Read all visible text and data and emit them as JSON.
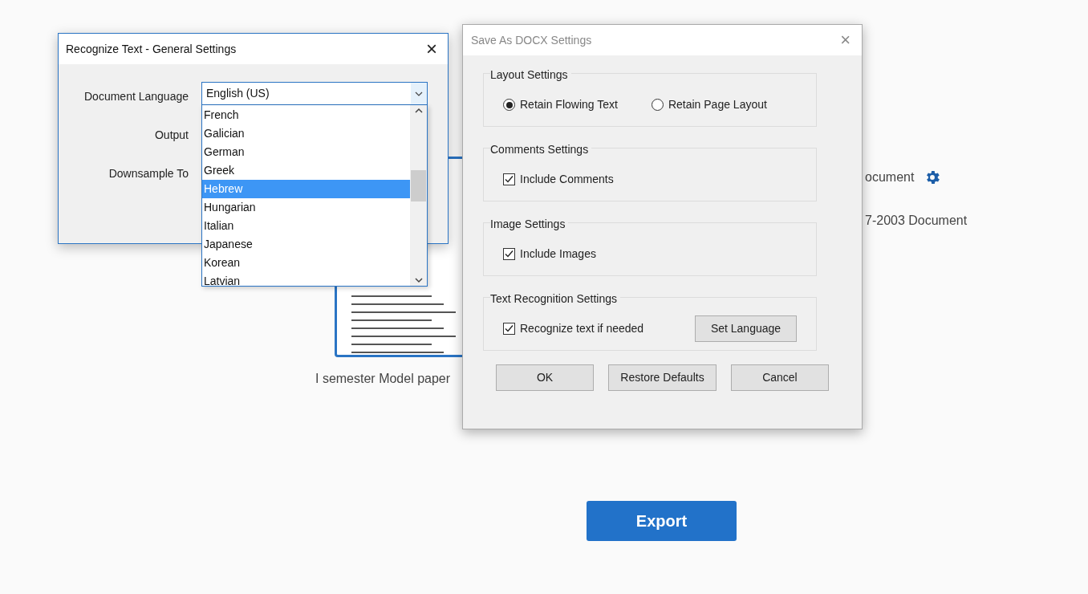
{
  "background": {
    "formats": [
      {
        "label": "ocument",
        "has_settings": true
      },
      {
        "label": "7-2003 Document",
        "has_settings": false
      }
    ],
    "thumbnail_caption": "I semester Model paper",
    "export_button": "Export"
  },
  "general_dialog": {
    "title": "Recognize Text - General Settings",
    "close": "×",
    "fields": [
      {
        "label": "Document Language"
      },
      {
        "label": "Output"
      },
      {
        "label": "Downsample To"
      }
    ],
    "language_select": {
      "value": "English (US)",
      "options": [
        {
          "label": "French",
          "selected": false
        },
        {
          "label": "Galician",
          "selected": false
        },
        {
          "label": "German",
          "selected": false
        },
        {
          "label": "Greek",
          "selected": false
        },
        {
          "label": "Hebrew",
          "selected": true
        },
        {
          "label": "Hungarian",
          "selected": false
        },
        {
          "label": "Italian",
          "selected": false
        },
        {
          "label": "Japanese",
          "selected": false
        },
        {
          "label": "Korean",
          "selected": false
        },
        {
          "label": "Latvian",
          "selected": false
        }
      ]
    }
  },
  "docx_dialog": {
    "title": "Save As DOCX Settings",
    "close": "×",
    "groups": [
      {
        "title": "Layout Settings",
        "items": [
          {
            "kind": "radio",
            "label": "Retain Flowing Text",
            "selected": true
          },
          {
            "kind": "radio",
            "label": "Retain Page Layout",
            "selected": false
          }
        ]
      },
      {
        "title": "Comments Settings",
        "items": [
          {
            "kind": "checkbox",
            "label": "Include Comments",
            "checked": true
          }
        ]
      },
      {
        "title": "Image Settings",
        "items": [
          {
            "kind": "checkbox",
            "label": "Include Images",
            "checked": true
          }
        ]
      },
      {
        "title": "Text Recognition Settings",
        "items": [
          {
            "kind": "checkbox",
            "label": "Recognize text if needed",
            "checked": true
          },
          {
            "kind": "button",
            "label": "Set Language"
          }
        ]
      }
    ],
    "buttons": [
      "OK",
      "Restore Defaults",
      "Cancel"
    ]
  }
}
